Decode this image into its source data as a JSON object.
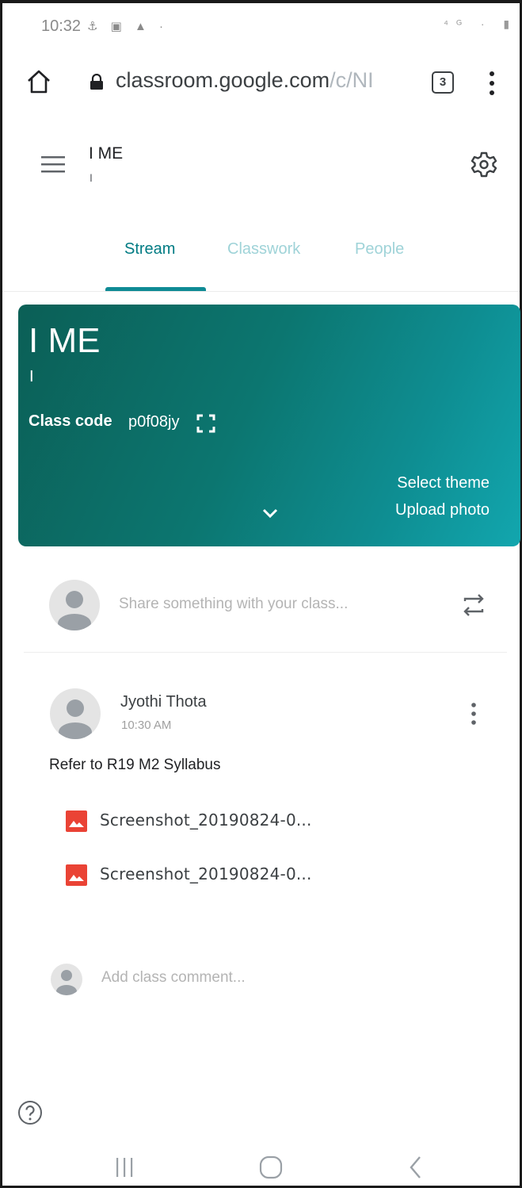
{
  "status_bar": {
    "time": "10:32",
    "left_icons": "⚓ ▣ ▲ ·",
    "right_icons": "⁴ᴳ ·  ▮"
  },
  "browser": {
    "url_host": "classroom.google.com",
    "url_path": "/c/NI",
    "tab_count": "3"
  },
  "header": {
    "class_name": "I ME",
    "class_section": "I"
  },
  "tabs": [
    {
      "label": "Stream",
      "active": true
    },
    {
      "label": "Classwork",
      "active": false
    },
    {
      "label": "People",
      "active": false
    }
  ],
  "banner": {
    "title": "I ME",
    "subtitle": "I",
    "class_code_label": "Class code",
    "class_code": "p0f08jy",
    "select_theme": "Select theme",
    "upload_photo": "Upload photo",
    "gradient_colors": [
      "#0b5f56",
      "#12a6ae"
    ]
  },
  "share": {
    "placeholder": "Share something with your class..."
  },
  "post": {
    "author": "Jyothi Thota",
    "time": "10:30 AM",
    "text": "Refer to R19 M2 Syllabus",
    "attachments": [
      {
        "name": "Screenshot_20190824-0...",
        "icon": "image-file-icon"
      },
      {
        "name": "Screenshot_20190824-0...",
        "icon": "image-file-icon"
      }
    ]
  },
  "comment": {
    "placeholder": "Add class comment..."
  },
  "colors": {
    "accent": "#007b83",
    "tab_inactive": "#9fd3d8",
    "attachment_red": "#ea4335"
  }
}
